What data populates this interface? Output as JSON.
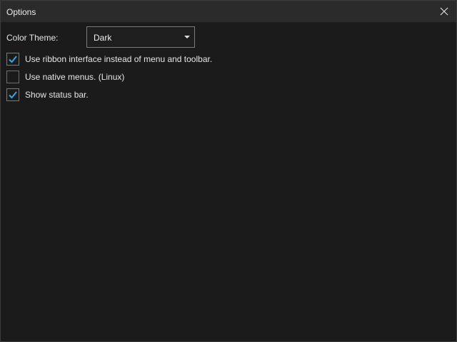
{
  "window": {
    "title": "Options"
  },
  "color_theme": {
    "label": "Color Theme:",
    "selected": "Dark"
  },
  "options": [
    {
      "label": "Use ribbon interface instead of menu and toolbar.",
      "checked": true
    },
    {
      "label": "Use native menus. (Linux)",
      "checked": false
    },
    {
      "label": "Show status bar.",
      "checked": true
    }
  ],
  "colors": {
    "background": "#1b1b1b",
    "titlebar": "#2b2b2b",
    "checkmark": "#2ea8e6"
  },
  "icons": {
    "close": "close-icon",
    "dropdown": "chevron-down-icon",
    "check": "check-icon"
  }
}
